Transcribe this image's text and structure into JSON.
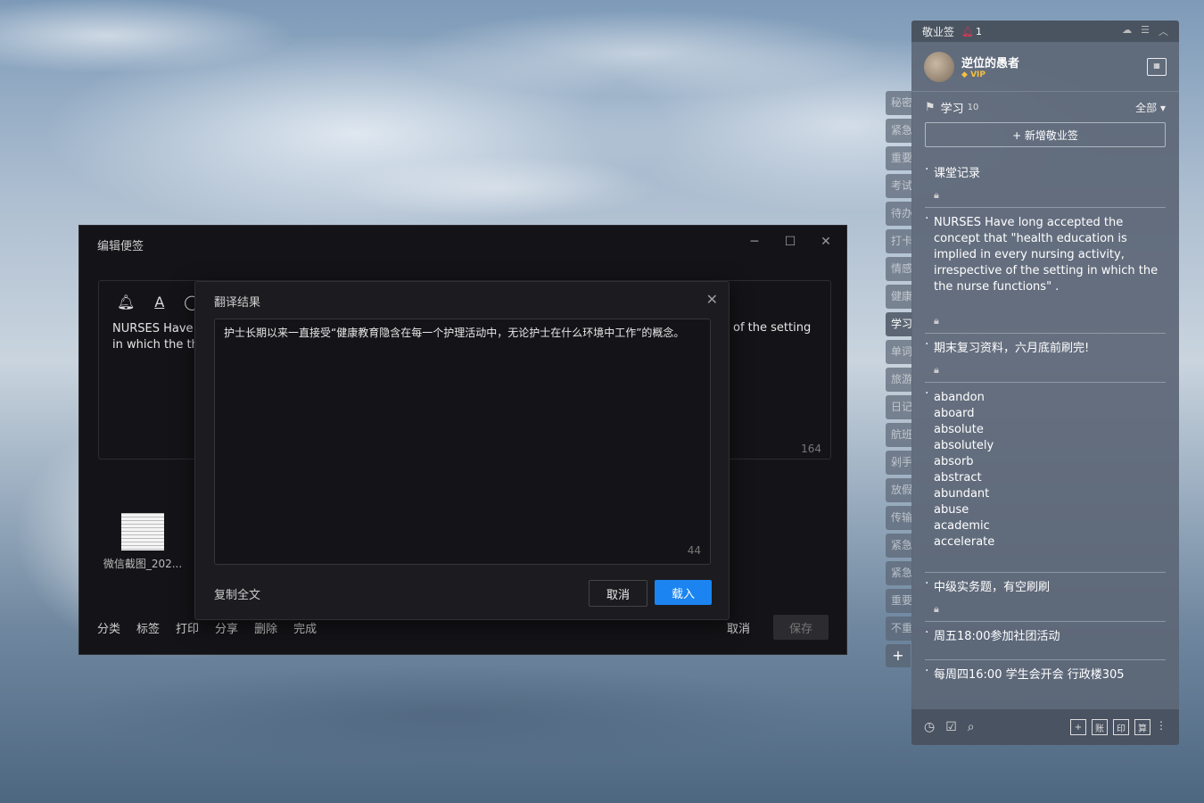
{
  "editor": {
    "title": "编辑便签",
    "window_controls": {
      "minimize": "─",
      "maximize": "☐",
      "close": "✕"
    },
    "toolbar_icons": [
      "bell-icon",
      "font-color-icon",
      "circle-icon"
    ],
    "note_text_left": "NURSES Have l\nin which the th",
    "note_text_right": "of the setting",
    "char_count": "164",
    "attachment_name": "微信截图_202...",
    "bottom_actions": [
      "分类",
      "标签",
      "打印",
      "分享",
      "删除",
      "完成"
    ],
    "cancel_label": "取消",
    "save_label": "保存"
  },
  "dialog": {
    "title": "翻译结果",
    "translated_text": "护士长期以来一直接受“健康教育隐含在每一个护理活动中，无论护士在什么环境中工作”的概念。",
    "char_count": "44",
    "copy_all_label": "复制全文",
    "cancel_label": "取消",
    "load_label": "载入"
  },
  "side_tabs": {
    "items": [
      "秘密",
      "紧急",
      "重要",
      "考试",
      "待办",
      "打卡",
      "情感",
      "健康",
      "学习",
      "单词",
      "旅游",
      "日记",
      "航班",
      "剁手",
      "放假",
      "传输",
      "紧急",
      "紧急",
      "重要",
      "不重"
    ],
    "active_index": 8,
    "add_label": "+"
  },
  "panel": {
    "app_name": "敬业签",
    "reminder_count": "1",
    "username": "逆位的愚者",
    "vip_label": "VIP",
    "category_name": "学习",
    "category_count": "10",
    "filter_label": "全部",
    "add_note_label": "+ 新增敬业签",
    "notes": [
      {
        "text": "课堂记录",
        "locked": true
      },
      {
        "text": "NURSES Have long accepted the concept that \"health education is implied in every nursing activity, irrespective of the setting in which the the nurse functions\" .",
        "locked": true
      },
      {
        "text": "期末复习资料，六月底前刷完!",
        "locked": true
      },
      {
        "text": "abandon\naboard\nabsolute\nabsolutely\nabsorb\nabstract\nabundant\nabuse\nacademic\naccelerate",
        "locked": false
      },
      {
        "text": "中级实务题，有空刷刷",
        "locked": true
      },
      {
        "text": "周五18:00参加社团活动",
        "locked": false
      },
      {
        "text": "每周四16:00 学生会开会 行政楼305",
        "locked": false
      }
    ],
    "footer_right": [
      "+",
      "账",
      "印",
      "算"
    ]
  }
}
